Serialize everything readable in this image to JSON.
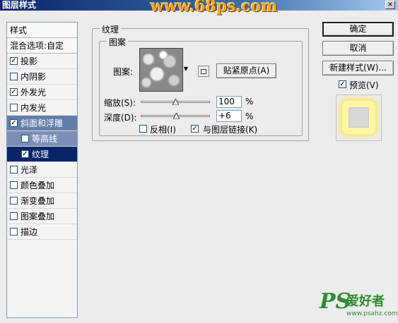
{
  "window": {
    "title": "图层样式",
    "watermark": "www.68ps.com",
    "close_label": "×"
  },
  "styles_panel": {
    "header": "样式",
    "blend_options": "混合选项:自定",
    "items": [
      {
        "label": "投影",
        "checked": true
      },
      {
        "label": "内阴影",
        "checked": false
      },
      {
        "label": "外发光",
        "checked": true
      },
      {
        "label": "内发光",
        "checked": false
      },
      {
        "label": "斜面和浮雕",
        "checked": true
      },
      {
        "label": "等高线",
        "checked": false
      },
      {
        "label": "纹理",
        "checked": true
      },
      {
        "label": "光泽",
        "checked": false
      },
      {
        "label": "颜色叠加",
        "checked": false
      },
      {
        "label": "渐变叠加",
        "checked": false
      },
      {
        "label": "图案叠加",
        "checked": false
      },
      {
        "label": "描边",
        "checked": false
      }
    ]
  },
  "texture": {
    "group_title": "纹理",
    "subgroup_title": "图案",
    "pattern_label": "图案:",
    "snap_origin_button": "贴紧原点(A)",
    "scale_label": "缩放(S):",
    "scale_value": "100",
    "scale_unit": "%",
    "scale_fraction": 0.5,
    "depth_label": "深度(D):",
    "depth_value": "+6",
    "depth_unit": "%",
    "depth_fraction": 0.52,
    "invert_label": "反相(I)",
    "invert_checked": false,
    "link_label": "与图层链接(K)",
    "link_checked": true
  },
  "buttons": {
    "ok": "确定",
    "cancel": "取消",
    "new_style": "新建样式(W)...",
    "preview_label": "预览(V)",
    "preview_checked": true
  },
  "brand": {
    "ps": "PS",
    "name": "爱好者",
    "url": "www.psahz.com"
  },
  "check_mark": "✓"
}
